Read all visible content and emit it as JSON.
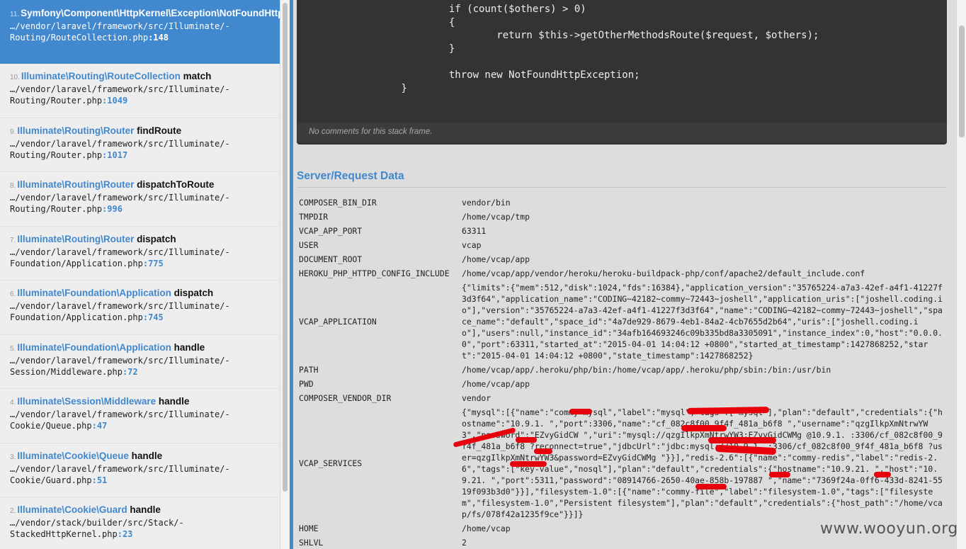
{
  "frames": [
    {
      "index": "11.",
      "class": "Symfony\\Component\\HttpKernel\\Exception\\NotFoundHttpException",
      "function": "",
      "file": "…/vendor/laravel/framework/src/Illuminate/-\nRouting/RouteCollection.php",
      "line": ":148",
      "active": true
    },
    {
      "index": "10.",
      "class": "Illuminate\\Routing\\RouteCollection",
      "function": "match",
      "file": "…/vendor/laravel/framework/src/Illuminate/-\nRouting/Router.php",
      "line": ":1049",
      "active": false
    },
    {
      "index": "9.",
      "class": "Illuminate\\Routing\\Router",
      "function": "findRoute",
      "file": "…/vendor/laravel/framework/src/Illuminate/-\nRouting/Router.php",
      "line": ":1017",
      "active": false
    },
    {
      "index": "8.",
      "class": "Illuminate\\Routing\\Router",
      "function": "dispatchToRoute",
      "file": "…/vendor/laravel/framework/src/Illuminate/-\nRouting/Router.php",
      "line": ":996",
      "active": false
    },
    {
      "index": "7.",
      "class": "Illuminate\\Routing\\Router",
      "function": "dispatch",
      "file": "…/vendor/laravel/framework/src/Illuminate/-\nFoundation/Application.php",
      "line": ":775",
      "active": false
    },
    {
      "index": "6.",
      "class": "Illuminate\\Foundation\\Application",
      "function": "dispatch",
      "file": "…/vendor/laravel/framework/src/Illuminate/-\nFoundation/Application.php",
      "line": ":745",
      "active": false
    },
    {
      "index": "5.",
      "class": "Illuminate\\Foundation\\Application",
      "function": "handle",
      "file": "…/vendor/laravel/framework/src/Illuminate/-\nSession/Middleware.php",
      "line": ":72",
      "active": false
    },
    {
      "index": "4.",
      "class": "Illuminate\\Session\\Middleware",
      "function": "handle",
      "file": "…/vendor/laravel/framework/src/Illuminate/-\nCookie/Queue.php",
      "line": ":47",
      "active": false
    },
    {
      "index": "3.",
      "class": "Illuminate\\Cookie\\Queue",
      "function": "handle",
      "file": "…/vendor/laravel/framework/src/Illuminate/-\nCookie/Guard.php",
      "line": ":51",
      "active": false
    },
    {
      "index": "2.",
      "class": "Illuminate\\Cookie\\Guard",
      "function": "handle",
      "file": "…/vendor/stack/builder/src/Stack/-\nStackedHttpKernel.php",
      "line": ":23",
      "active": false
    }
  ],
  "code_lines": [
    "                if (count($others) > 0)",
    "                {",
    "                        return $this->getOtherMethodsRoute($request, $others);",
    "                }",
    "",
    "                throw new NotFoundHttpException;",
    "        }"
  ],
  "comments_text": "No comments for this stack frame.",
  "section_title": "Server/Request Data",
  "server_data": [
    {
      "key": "COMPOSER_BIN_DIR",
      "value": "vendor/bin"
    },
    {
      "key": "TMPDIR",
      "value": "/home/vcap/tmp"
    },
    {
      "key": "VCAP_APP_PORT",
      "value": "63311"
    },
    {
      "key": "USER",
      "value": "vcap"
    },
    {
      "key": "DOCUMENT_ROOT",
      "value": "/home/vcap/app"
    },
    {
      "key": "HEROKU_PHP_HTTPD_CONFIG_INCLUDE",
      "value": "/home/vcap/app/vendor/heroku/heroku-buildpack-php/conf/apache2/default_include.conf"
    },
    {
      "key": "VCAP_APPLICATION",
      "value": "{\"limits\":{\"mem\":512,\"disk\":1024,\"fds\":16384},\"application_version\":\"35765224-a7a3-42ef-a4f1-41227f3d3f64\",\"application_name\":\"CODING~42182~commy~72443~joshell\",\"application_uris\":[\"joshell.coding.io\"],\"version\":\"35765224-a7a3-42ef-a4f1-41227f3d3f64\",\"name\":\"CODING~42182~commy~72443~joshell\",\"space_name\":\"default\",\"space_id\":\"4a7de929-8679-4eb1-84a2-4cb7655d2b64\",\"uris\":[\"joshell.coding.io\"],\"users\":null,\"instance_id\":\"34afb164693246c09b335bd8a3305091\",\"instance_index\":0,\"host\":\"0.0.0.0\",\"port\":63311,\"started_at\":\"2015-04-01 14:04:12 +0800\",\"started_at_timestamp\":1427868252,\"start\":\"2015-04-01 14:04:12 +0800\",\"state_timestamp\":1427868252}"
    },
    {
      "key": "PATH",
      "value": "/home/vcap/app/.heroku/php/bin:/home/vcap/app/.heroku/php/sbin:/bin:/usr/bin"
    },
    {
      "key": "PWD",
      "value": "/home/vcap/app"
    },
    {
      "key": "COMPOSER_VENDOR_DIR",
      "value": "vendor"
    },
    {
      "key": "VCAP_SERVICES",
      "value": "{\"mysql\":[{\"name\":\"commy-mysql\",\"label\":\"mysql\",\"tags\":[\"mysql\"],\"plan\":\"default\",\"credentials\":{\"hostname\":\"10.9.1.   \",\"port\":3306,\"name\":\"cf_082c8f00_9f4f_481a_b6f8             \",\"username\":\"qzgIlkpXmNtrwYW3\",\"password\":\"EZvyGidCW         \",\"uri\":\"mysql://qzgIlkpXmNtrwYW3:EZvyGidCWMg    @10.9.1.   :3306/cf_082c8f00_9f4f_481a_b6f8         ?reconnect=true\",\"jdbcUrl\":\"jdbc:mysql://10.9.1.  :3306/cf_082c8f00_9f4f_481a_b6f8           ?user=qzgIlkpXmNtrwYW3&password=EZvyGidCWMg      \"}}],\"redis-2.6\":[{\"name\":\"commy-redis\",\"label\":\"redis-2.6\",\"tags\":[\"key-value\",\"nosql\"],\"plan\":\"default\",\"credentials\":{\"hostname\":\"10.9.21.   \",\"host\":\"10.9.21.   \",\"port\":5311,\"password\":\"08914766-2650-40ae-858b-197887       \",\"name\":\"7369f24a-0ff6-433d-8241-5519f093b3d0\"}}],\"filesystem-1.0\":[{\"name\":\"commy-file\",\"label\":\"filesystem-1.0\",\"tags\":[\"filesystem\",\"filesystem-1.0\",\"Persistent filesystem\"],\"plan\":\"default\",\"credentials\":{\"host_path\":\"/home/vcap/fs/078f42a1235f9ce\"}}]}"
    },
    {
      "key": "HOME",
      "value": "/home/vcap"
    },
    {
      "key": "SHLVL",
      "value": "2"
    }
  ],
  "watermark": "www.wooyun.org",
  "colors": {
    "accent": "#4288ce",
    "redaction": "#e8000c"
  }
}
